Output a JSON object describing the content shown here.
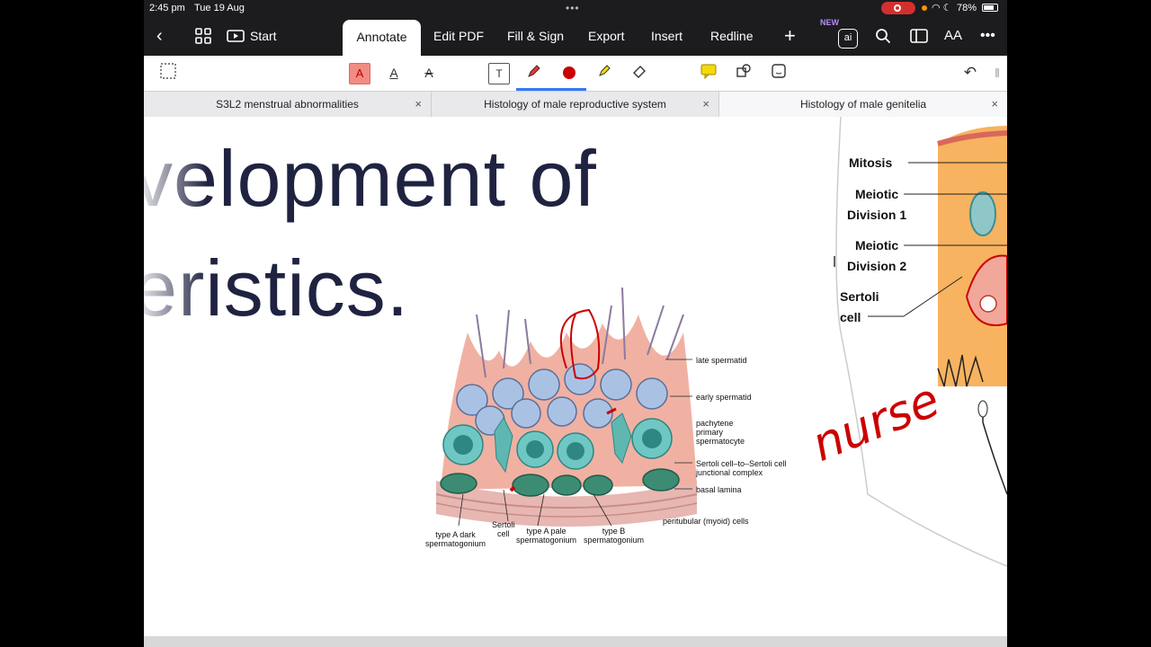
{
  "status_bar": {
    "time": "2:45 pm",
    "date": "Tue 19 Aug",
    "battery": "78%"
  },
  "toolbar": {
    "tabs": [
      "Annotate",
      "Edit PDF",
      "Fill & Sign",
      "Export",
      "Insert",
      "Redline"
    ],
    "start_label": "Start",
    "new_badge": "NEW",
    "ai_label": "ai"
  },
  "document_tabs": [
    {
      "title": "S3L2 menstrual abnormalities"
    },
    {
      "title": "Histology of male reproductive system"
    },
    {
      "title": "Histology of male genitelia"
    }
  ],
  "slide": {
    "heading_line1": "velopment of",
    "heading_line2": "eristics."
  },
  "figure_labels": {
    "late_spermatid": "late spermatid",
    "early_spermatid": "early spermatid",
    "pachytene_1": "pachytene",
    "pachytene_2": "primary",
    "pachytene_3": "spermatocyte",
    "sertoli_junction_1": "Sertoli cell–to–Sertoli cell",
    "sertoli_junction_2": "junctional complex",
    "basal_lamina": "basal lamina",
    "peritubular": "peritubular (myoid) cells",
    "type_a_dark_1": "type A dark",
    "type_a_dark_2": "spermatogonium",
    "sertoli_cell_1": "Sertoli",
    "sertoli_cell_2": "cell",
    "type_a_pale_1": "type A pale",
    "type_a_pale_2": "spermatogonium",
    "type_b_1": "type B",
    "type_b_2": "spermatogonium"
  },
  "right_figure_labels": {
    "mitosis": "Mitosis",
    "meiotic1_a": "Meiotic",
    "meiotic1_b": "Division 1",
    "meiotic2_a": "Meiotic",
    "meiotic2_b": "Division 2",
    "sertoli_a": "Sertoli",
    "sertoli_b": "cell"
  },
  "handwriting": "nurse",
  "colors": {
    "annotation_red": "#cc0000",
    "heading_navy": "#1f2341",
    "active_tool_underline": "#3478f6"
  }
}
